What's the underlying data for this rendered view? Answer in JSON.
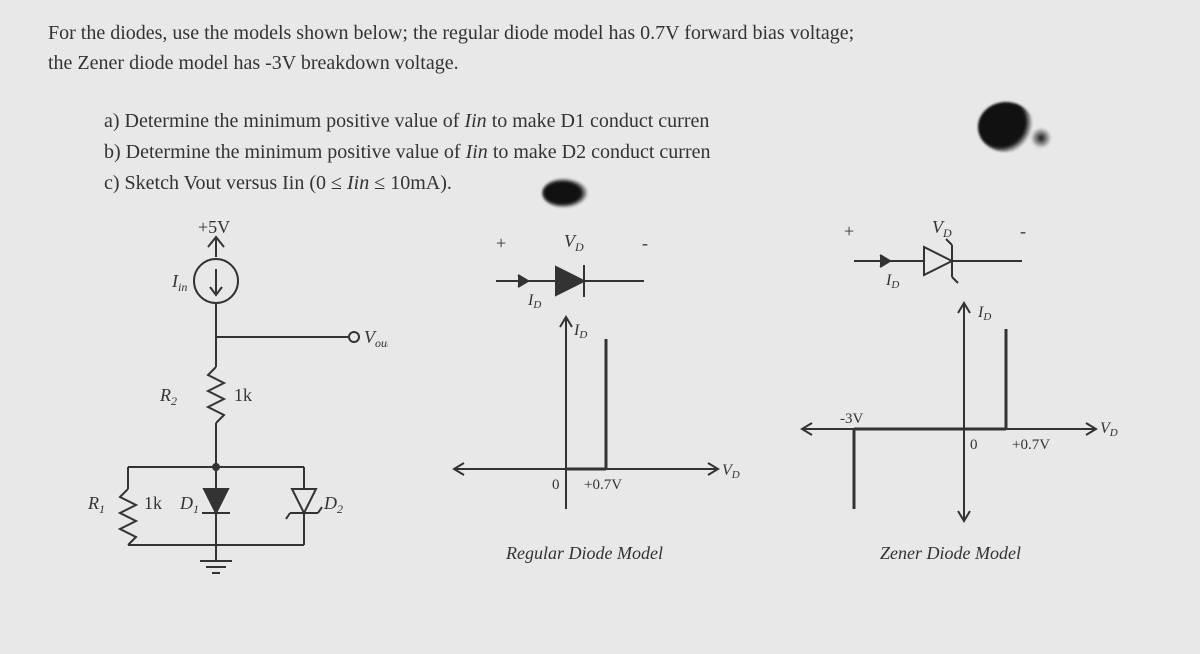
{
  "intro": {
    "line1": "For the diodes, use the models shown below; the regular diode model has 0.7V forward bias voltage;",
    "line2": "the Zener diode model has -3V breakdown voltage."
  },
  "questions": {
    "a": "a) Determine the minimum positive value of ",
    "a_var": "Iin",
    "a_rest": " to make D1 conduct curren",
    "b": "b) Determine the minimum positive value of ",
    "b_var": "Iin",
    "b_rest": " to make D2 conduct curren",
    "c": "c) Sketch Vout versus Iin (0 ≤ ",
    "c_var": "Iin",
    "c_rest": " ≤ 10mA)."
  },
  "circuit": {
    "vplus": "+5V",
    "iin": "Iin",
    "vout": "Vout",
    "r1": "R₁",
    "r1v": "1k",
    "r2": "R₂",
    "r2v": "1k",
    "d1": "D₁",
    "d2": "D₂"
  },
  "regular": {
    "vd": "V",
    "vd_sub": "D",
    "id": "I",
    "id_sub": "D",
    "plus": "+",
    "minus": "-",
    "zero": "0",
    "v07": "+0.7V",
    "caption": "Regular Diode Model"
  },
  "zener": {
    "vd": "V",
    "vd_sub": "D",
    "id": "I",
    "id_sub": "D",
    "plus": "+",
    "minus": "-",
    "neg3": "-3V",
    "zero": "0",
    "v07": "+0.7V",
    "caption": "Zener Diode Model"
  }
}
